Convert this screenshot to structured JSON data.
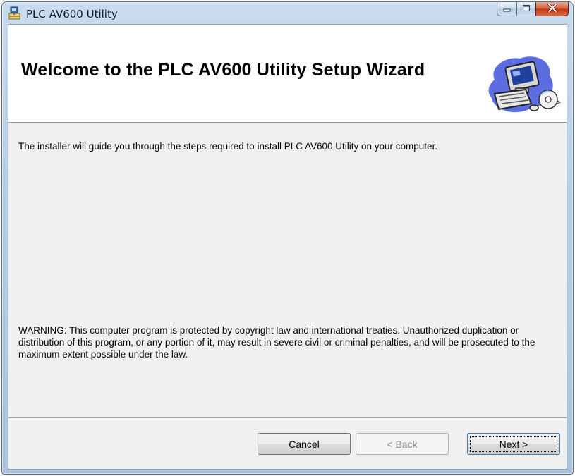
{
  "window": {
    "title": "PLC AV600 Utility",
    "icons": {
      "app": "installer-icon",
      "minimize": "minimize-icon",
      "maximize": "maximize-icon",
      "close": "close-icon"
    }
  },
  "banner": {
    "title": "Welcome to the PLC AV600 Utility Setup Wizard",
    "graphic": "computer-cd-graphic"
  },
  "body": {
    "intro": "The installer will guide you through the steps required to install PLC AV600 Utility on your computer.",
    "warning": "WARNING: This computer program is protected by copyright law and international treaties. Unauthorized duplication or distribution of this program, or any portion of it, may result in severe civil or criminal penalties, and will be prosecuted to the maximum extent possible under the law."
  },
  "buttons": {
    "cancel": "Cancel",
    "back": "< Back",
    "next": "Next >"
  },
  "colors": {
    "close_button": "#c23a14",
    "default_button_border": "#3c7fb1",
    "disabled_text": "#8a8a8a"
  }
}
